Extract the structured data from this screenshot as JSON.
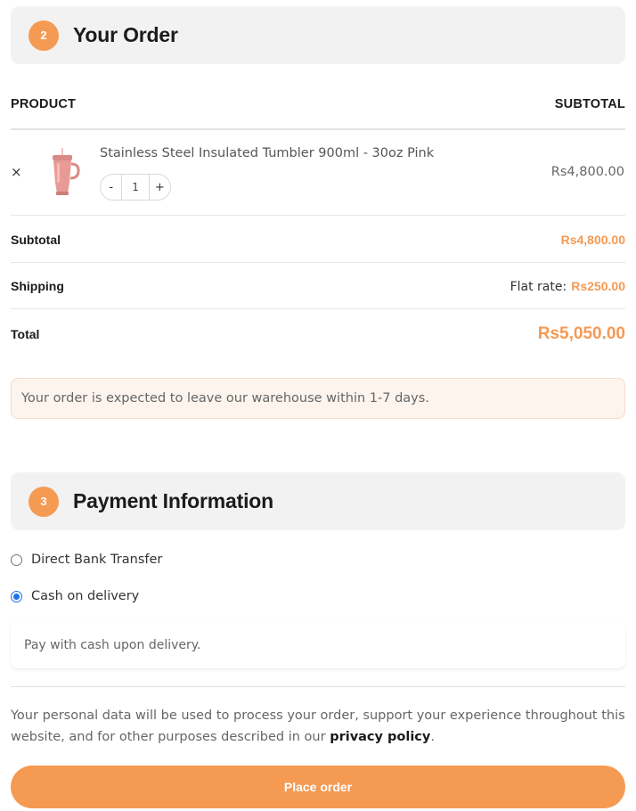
{
  "order_section": {
    "step": "2",
    "title": "Your Order"
  },
  "table": {
    "col_product": "PRODUCT",
    "col_subtotal": "SUBTOTAL"
  },
  "item": {
    "remove": "×",
    "name": "Stainless Steel Insulated Tumbler 900ml - 30oz Pink",
    "qty_minus": "-",
    "qty": "1",
    "qty_plus": "+",
    "price": "Rs4,800.00",
    "thumb_color": "#e89a96"
  },
  "subtotal": {
    "label": "Subtotal",
    "value": "Rs4,800.00"
  },
  "shipping": {
    "label": "Shipping",
    "method": "Flat rate:",
    "value": "Rs250.00"
  },
  "total": {
    "label": "Total",
    "value": "Rs5,050.00"
  },
  "notice": "Your order is expected to leave our warehouse within 1-7 days.",
  "payment_section": {
    "step": "3",
    "title": "Payment Information"
  },
  "payment_options": [
    {
      "label": "Direct Bank Transfer",
      "selected": false
    },
    {
      "label": "Cash on delivery",
      "selected": true
    }
  ],
  "payment_description": "Pay with cash upon delivery.",
  "privacy": {
    "text": "Your personal data will be used to process your order, support your experience throughout this website, and for other purposes described in our ",
    "link": "privacy policy",
    "end": "."
  },
  "place_order_label": "Place order",
  "colors": {
    "accent": "#f59a53",
    "radio_selected": "#1a73e8"
  }
}
